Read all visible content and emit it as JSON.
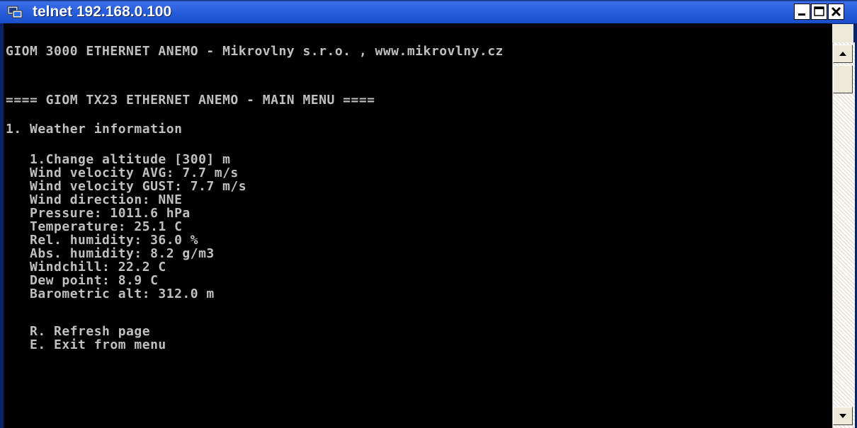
{
  "window": {
    "title": "telnet 192.168.0.100",
    "icon": "terminal-icon",
    "controls": [
      "minimize-icon",
      "maximize-icon",
      "close-icon"
    ],
    "colors": {
      "titlebar": "#2a5fdc",
      "console_bg": "#000000",
      "console_text": "#c0c0c0"
    }
  },
  "terminal": {
    "lines": [
      "GIOM 3000 ETHERNET ANEMO - Mikrovlny s.r.o. , www.mikrovlny.cz",
      "==== GIOM TX23 ETHERNET ANEMO - MAIN MENU ====",
      "1. Weather information",
      "   1.Change altitude [300] m",
      "   Wind velocity AVG: 7.7 m/s",
      "   Wind velocity GUST: 7.7 m/s",
      "   Wind direction: NNE",
      "   Pressure: 1011.6 hPa",
      "   Temperature: 25.1 C",
      "   Rel. humidity: 36.0 %",
      "   Abs. humidity: 8.2 g/m3",
      "   Windchill: 22.2 C",
      "   Dew point: 8.9 C",
      "   Barometric alt: 312.0 m",
      "   R. Refresh page",
      "   E. Exit from menu"
    ]
  }
}
